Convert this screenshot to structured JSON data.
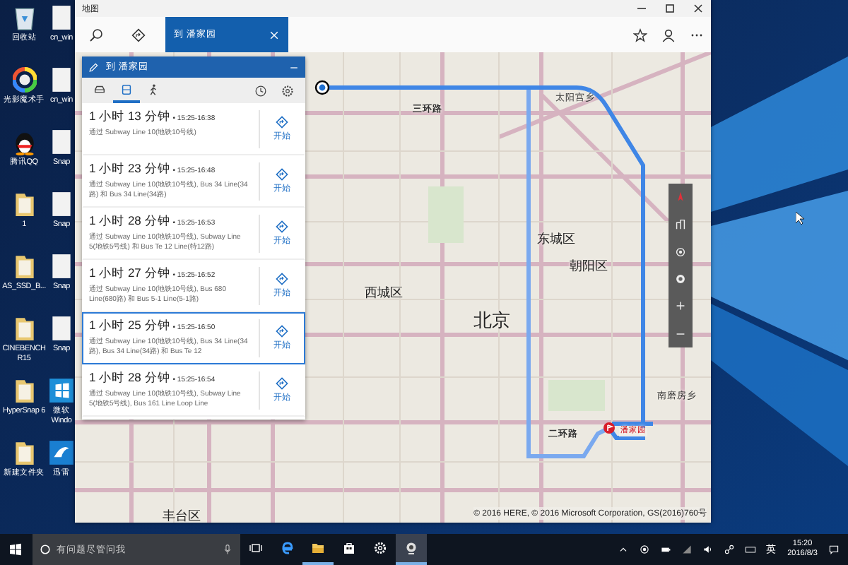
{
  "desktop_icons": [
    {
      "label": "回收站",
      "kind": "recycle"
    },
    {
      "label": "光影魔术手",
      "kind": "wheel"
    },
    {
      "label": "腾讯QQ",
      "kind": "penguin"
    },
    {
      "label": "1",
      "kind": "folder"
    },
    {
      "label": "AS_SSD_B...",
      "kind": "folder"
    },
    {
      "label": "CINEBENCH R15",
      "kind": "folder"
    },
    {
      "label": "HyperSnap 6",
      "kind": "folder"
    },
    {
      "label": "新建文件夹",
      "kind": "folder"
    }
  ],
  "desktop_icons_column_2": [
    {
      "label": "cn_win",
      "kind": "page"
    },
    {
      "label": "cn_win",
      "kind": "page"
    },
    {
      "label": "Snap",
      "kind": "page"
    },
    {
      "label": "Snap",
      "kind": "page"
    },
    {
      "label": "Snap",
      "kind": "page"
    },
    {
      "label": "Snap",
      "kind": "page"
    },
    {
      "label": "微软 Windo",
      "kind": "windows"
    },
    {
      "label": "迅雷",
      "kind": "bird"
    }
  ],
  "window": {
    "title": "地图"
  },
  "toolbar": {
    "destination_tab": "到 潘家园"
  },
  "route_panel": {
    "title": "到 潘家园",
    "modes": [
      {
        "kind": "car",
        "selected": false
      },
      {
        "kind": "transit",
        "selected": true
      },
      {
        "kind": "walk",
        "selected": false
      }
    ],
    "routes": [
      {
        "duration": "1 小时 13 分钟",
        "time": "• 15:25-16:38",
        "via": "通过 Subway Line 10(地铁10号线)",
        "action": "开始",
        "selected": false
      },
      {
        "duration": "1 小时 23 分钟",
        "time": "• 15:25-16:48",
        "via": "通过 Subway Line 10(地铁10号线), Bus 34 Line(34路) 和 Bus 34 Line(34路)",
        "action": "开始",
        "selected": false
      },
      {
        "duration": "1 小时 28 分钟",
        "time": "• 15:25-16:53",
        "via": "通过 Subway Line 10(地铁10号线), Subway Line 5(地铁5号线) 和 Bus Te 12 Line(特12路)",
        "action": "开始",
        "selected": false
      },
      {
        "duration": "1 小时 27 分钟",
        "time": "• 15:25-16:52",
        "via": "通过 Subway Line 10(地铁10号线), Bus 680 Line(680路) 和 Bus 5-1 Line(5-1路)",
        "action": "开始",
        "selected": false
      },
      {
        "duration": "1 小时 25 分钟",
        "time": "• 15:25-16:50",
        "via": "通过 Subway Line 10(地铁10号线), Bus 34 Line(34路), Bus 34 Line(34路) 和 Bus Te 12",
        "action": "开始",
        "selected": true
      },
      {
        "duration": "1 小时 28 分钟",
        "time": "• 15:25-16:54",
        "via": "通过 Subway Line 10(地铁10号线), Subway Line 5(地铁5号线), Bus 161 Line Loop Line",
        "action": "开始",
        "selected": false
      }
    ]
  },
  "map": {
    "labels": [
      {
        "text": "三环路",
        "kind": "road"
      },
      {
        "text": "太阳宫乡",
        "kind": "area"
      },
      {
        "text": "东城区",
        "kind": "district"
      },
      {
        "text": "朝阳区",
        "kind": "district"
      },
      {
        "text": "西城区",
        "kind": "district"
      },
      {
        "text": "北京",
        "kind": "city"
      },
      {
        "text": "南磨房乡",
        "kind": "area"
      },
      {
        "text": "潘家园",
        "kind": "place"
      },
      {
        "text": "二环路",
        "kind": "road"
      },
      {
        "text": "丰台区",
        "kind": "district"
      }
    ],
    "copyright": "© 2016 HERE, © 2016 Microsoft Corporation, GS(2016)760号"
  },
  "taskbar": {
    "search_placeholder": "有问题尽管问我",
    "apps": [
      {
        "kind": "taskview",
        "running": false,
        "active": false
      },
      {
        "kind": "edge",
        "running": false,
        "active": false
      },
      {
        "kind": "explorer",
        "running": true,
        "active": false
      },
      {
        "kind": "store",
        "running": false,
        "active": false
      },
      {
        "kind": "settings",
        "running": false,
        "active": false
      },
      {
        "kind": "camera",
        "running": true,
        "active": true
      }
    ],
    "ime": "英",
    "time": "15:20",
    "date": "2016/8/3"
  }
}
